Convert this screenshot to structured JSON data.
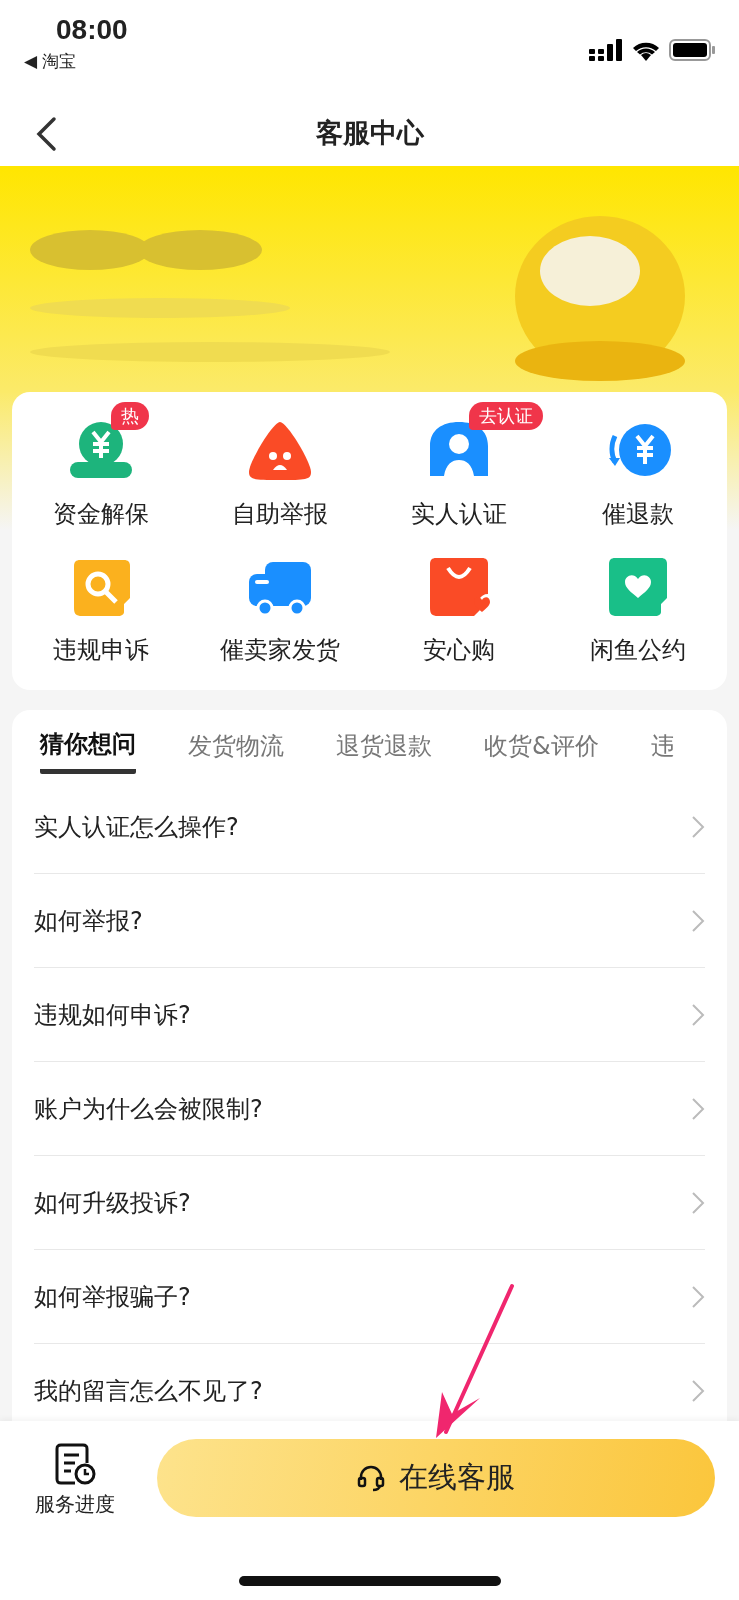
{
  "status_bar": {
    "time": "08:00",
    "back_app": "◀ 淘宝"
  },
  "nav": {
    "title": "客服中心"
  },
  "banner": {
    "kind": "picture"
  },
  "services": [
    {
      "label": "资金解保",
      "badge": "热"
    },
    {
      "label": "自助举报"
    },
    {
      "label": "实人认证",
      "badge": "去认证"
    },
    {
      "label": "催退款"
    },
    {
      "label": "违规申诉"
    },
    {
      "label": "催卖家发货"
    },
    {
      "label": "安心购"
    },
    {
      "label": "闲鱼公约"
    }
  ],
  "tabs": [
    {
      "label": "猜你想问",
      "selected": true
    },
    {
      "label": "发货物流",
      "selected": false
    },
    {
      "label": "退货退款",
      "selected": false
    },
    {
      "label": "收货&评价",
      "selected": false
    },
    {
      "label": "违",
      "selected": false
    }
  ],
  "questions": [
    "实人认证怎么操作?",
    "如何举报?",
    "违规如何申诉?",
    "账户为什么会被限制?",
    "如何升级投诉?",
    "如何举报骗子?",
    "我的留言怎么不见了?"
  ],
  "bottom_bar": {
    "progress_label": "服务进度",
    "online_button": "在线客服"
  }
}
